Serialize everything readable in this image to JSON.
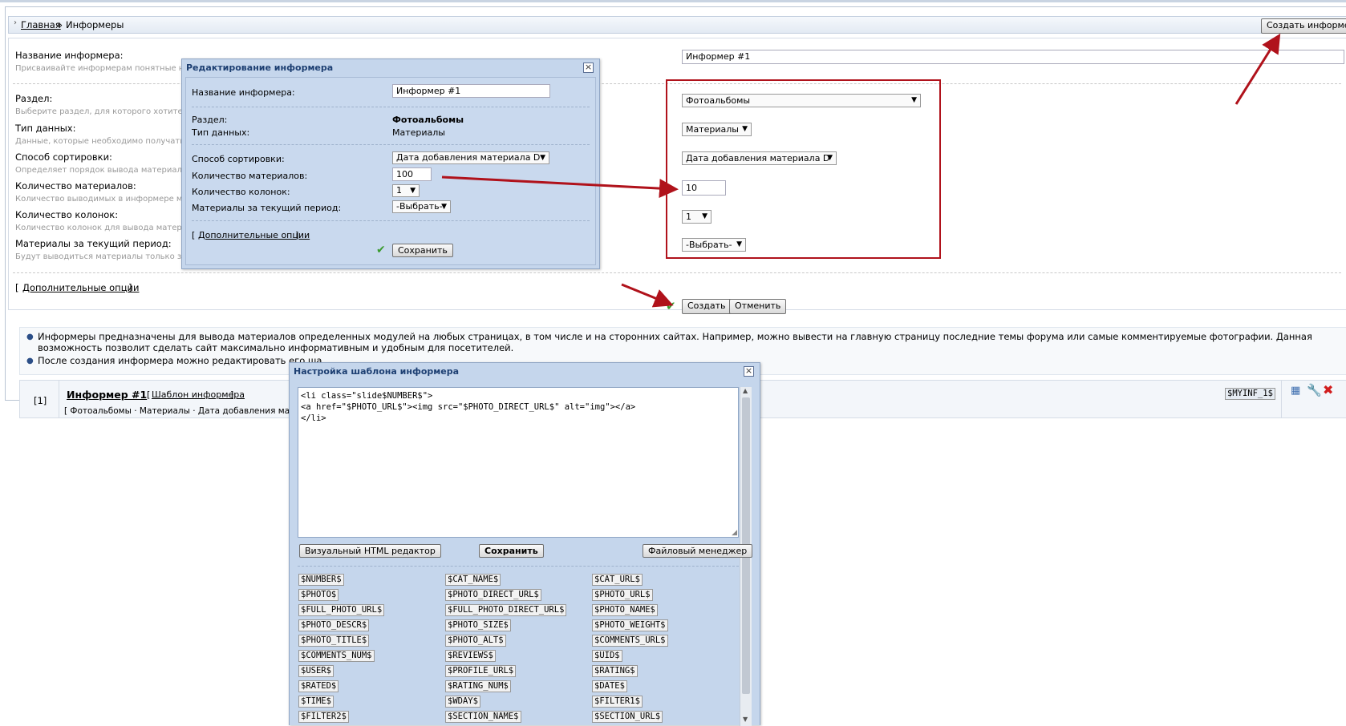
{
  "breadcrumb": {
    "home": "Главная",
    "sep": "»",
    "current": "Информеры"
  },
  "create_informer_button": "Создать информер",
  "form": {
    "name_label": "Название информера:",
    "name_hint": "Присваивайте информерам понятные наз",
    "name_value": "Информер #1",
    "section_label": "Раздел:",
    "section_hint": "Выберите раздел, для которого хотите со",
    "section_value": "Фотоальбомы",
    "datatype_label": "Тип данных:",
    "datatype_hint": "Данные, которые необходимо получать д",
    "datatype_value": "Материалы",
    "sort_label": "Способ сортировки:",
    "sort_hint": "Определяет порядок вывода материалов.",
    "sort_value": "Дата добавления материала D",
    "count_label": "Количество материалов:",
    "count_hint": "Количество выводимых в информере мате",
    "count_value": "10",
    "columns_label": "Количество колонок:",
    "columns_hint": "Количество колонок для вывода материал",
    "columns_value": "1",
    "period_label": "Материалы за текущий период:",
    "period_hint": "Будут выводиться материалы только за те",
    "period_value": "-Выбрать-",
    "extra_open": "[",
    "extra_link": "Дополнительные опции",
    "extra_close": "]",
    "create_button": "Создать",
    "cancel_button": "Отменить"
  },
  "info": {
    "item1": "Информеры предназначены для вывода материалов определенных модулей на любых страницах, в том числе и на сторонних сайтах. Например, можно вывести на главную страницу последние темы форума или самые комментируемые фотографии. Данная возможность позволит сделать сайт максимально информативным и удобным для посетителей.",
    "item2": "После создания информера можно редактировать его ша"
  },
  "list_row": {
    "number": "[1]",
    "title": "Информер #1",
    "template_open": "[",
    "template_link": "Шаблон информера",
    "template_close": "]",
    "meta": "[ Фотоальбомы · Материалы · Дата добавления материал",
    "code": "$MYINF_1$"
  },
  "edit_dialog": {
    "title": "Редактирование информера",
    "name_label": "Название информера:",
    "name_value": "Информер #1",
    "section_label": "Раздел:",
    "section_value": "Фотоальбомы",
    "datatype_label": "Тип данных:",
    "datatype_value": "Материалы",
    "sort_label": "Способ сортировки:",
    "sort_value": "Дата добавления материала D",
    "count_label": "Количество материалов:",
    "count_value": "100",
    "columns_label": "Количество колонок:",
    "columns_value": "1",
    "period_label": "Материалы за текущий период:",
    "period_value": "-Выбрать-",
    "extra_open": "[",
    "extra_link": "Дополнительные опции",
    "extra_close": "]",
    "save_button": "Сохранить"
  },
  "template_dialog": {
    "title": "Настройка шаблона информера",
    "code": "<li class=\"slide$NUMBER$\">\n<a href=\"$PHOTO_URL$\"><img src=\"$PHOTO_DIRECT_URL$\" alt=\"img\"></a>\n</li>",
    "visual_editor_button": "Визуальный HTML редактор",
    "save_button": "Сохранить",
    "file_manager_button": "Файловый менеджер",
    "tags": [
      "$NUMBER$",
      "$CAT_NAME$",
      "$CAT_URL$",
      "$PHOTO$",
      "$PHOTO_DIRECT_URL$",
      "$PHOTO_URL$",
      "$FULL_PHOTO_URL$",
      "$FULL_PHOTO_DIRECT_URL$",
      "$PHOTO_NAME$",
      "$PHOTO_DESCR$",
      "$PHOTO_SIZE$",
      "$PHOTO_WEIGHT$",
      "$PHOTO_TITLE$",
      "$PHOTO_ALT$",
      "$COMMENTS_URL$",
      "$COMMENTS_NUM$",
      "$REVIEWS$",
      "$UID$",
      "$USER$",
      "$PROFILE_URL$",
      "$RATING$",
      "$RATED$",
      "$RATING_NUM$",
      "$DATE$",
      "$TIME$",
      "$WDAY$",
      "$FILTER1$",
      "$FILTER2$",
      "$SECTION_NAME$",
      "$SECTION_URL$"
    ]
  },
  "colors": {
    "accent_red": "#b0121b",
    "dialog_bg": "#c5d6ec",
    "dialog_title": "#1d3f72"
  }
}
